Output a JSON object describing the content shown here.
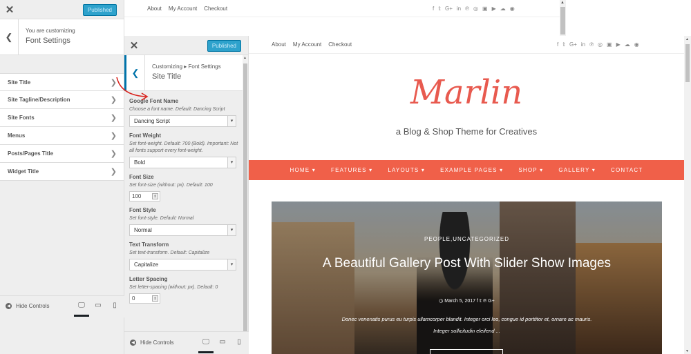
{
  "back_customizer": {
    "publish_label": "Published",
    "pre_title": "You are customizing",
    "title": "Font Settings",
    "items": [
      {
        "label": "Site Title"
      },
      {
        "label": "Site Tagline/Description"
      },
      {
        "label": "Site Fonts"
      },
      {
        "label": "Menus"
      },
      {
        "label": "Posts/Pages Title"
      },
      {
        "label": "Widget Title"
      }
    ],
    "hide_controls": "Hide Controls"
  },
  "front_customizer": {
    "publish_label": "Published",
    "breadcrumb": "Customizing ▸ Font Settings",
    "title": "Site Title",
    "font_name": {
      "label": "Google Font Name",
      "desc": "Choose a font name. Default: Dancing Script",
      "value": "Dancing Script"
    },
    "font_weight": {
      "label": "Font Weight",
      "desc": "Set font-weight. Default: 700 (Bold). Important: Not all fonts support every font-weight.",
      "value": "Bold"
    },
    "font_size": {
      "label": "Font Size",
      "desc": "Set font-size (without: px). Default: 100",
      "value": "100"
    },
    "font_style": {
      "label": "Font Style",
      "desc": "Set font-style. Default: Normal",
      "value": "Normal"
    },
    "text_transform": {
      "label": "Text Transform",
      "desc": "Set text-transform. Default: Capitalize",
      "value": "Capitalize"
    },
    "letter_spacing": {
      "label": "Letter Spacing",
      "desc": "Set letter-spacing (without: px). Default: 0",
      "value": "0"
    },
    "hide_controls": "Hide Controls"
  },
  "preview": {
    "top_nav": [
      "About",
      "My Account",
      "Checkout"
    ],
    "social_icons": [
      "f",
      "𝕥",
      "G+",
      "in",
      "℗",
      "◎",
      "▣",
      "▶",
      "☁",
      "◉"
    ],
    "brand": "Marlin",
    "tagline": "a Blog & Shop Theme for Creatives",
    "main_nav": [
      "HOME ▾",
      "FEATURES ▾",
      "LAYOUTS ▾",
      "EXAMPLE PAGES ▾",
      "SHOP ▾",
      "GALLERY ▾",
      "CONTACT"
    ],
    "hero": {
      "categories": "PEOPLE,UNCATEGORIZED",
      "title": "A Beautiful Gallery Post With Slider Show Images",
      "date": "◷ March 5, 2017   f   𝕥   ℗   G+",
      "excerpt": "Donec venenatis purus eu turpis ullamcorper blandit. Integer orci leo, congue id porttitor et, ornare ac mauris. Integer sollicitudin eleifend ..."
    }
  },
  "colors": {
    "accent": "#f06049",
    "brand": "#e85a4f",
    "publish": "#2ea2cc"
  }
}
